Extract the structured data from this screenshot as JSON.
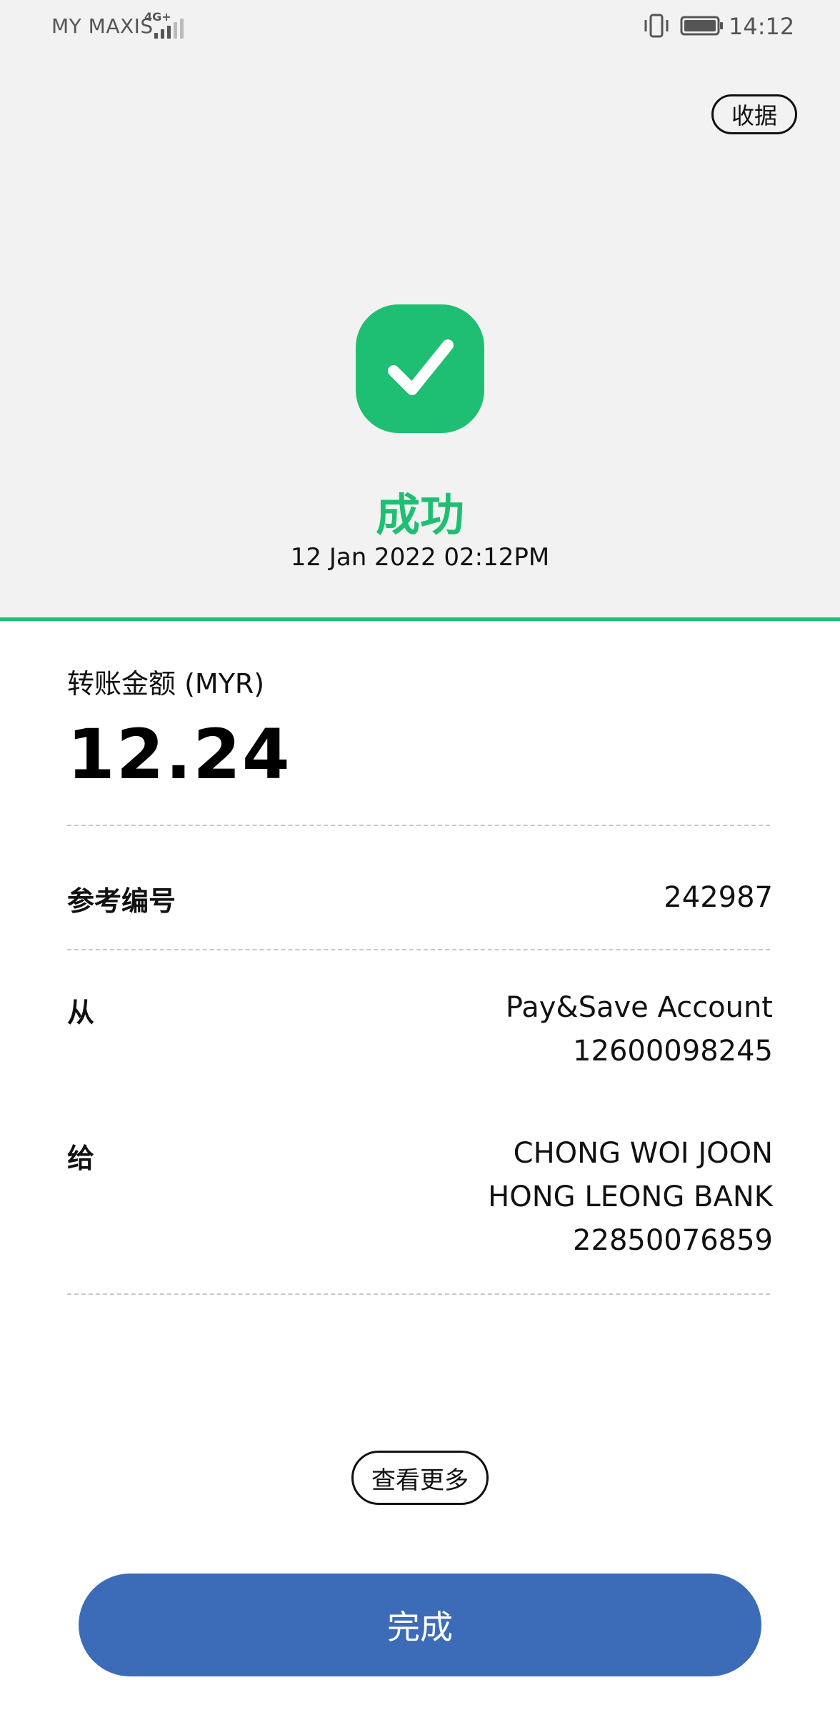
{
  "status_bar": {
    "carrier": "MY MAXIS",
    "network": "4G+",
    "time": "14:12"
  },
  "header": {
    "receipt_label": "收据",
    "status_text": "成功",
    "datetime": "12 Jan 2022 02:12PM",
    "accent_color": "#1fbf73"
  },
  "amount": {
    "label": "转账金额 (MYR)",
    "value": "12.24"
  },
  "reference": {
    "label": "参考编号",
    "value": "242987"
  },
  "from": {
    "label": "从",
    "account_name": "Pay&Save Account",
    "account_number": "12600098245"
  },
  "to": {
    "label": "给",
    "name": "CHONG WOI JOON",
    "bank": "HONG LEONG BANK",
    "account_number": "22850076859"
  },
  "actions": {
    "more_label": "查看更多",
    "done_label": "完成",
    "done_color": "#3c6cb8"
  }
}
